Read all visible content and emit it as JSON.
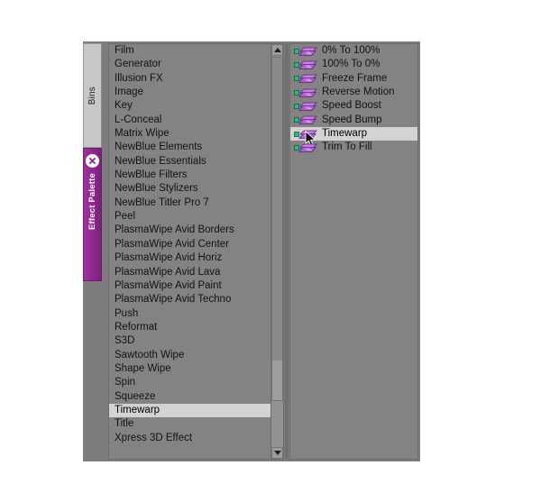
{
  "window": {
    "title": "Effect Palette",
    "background_color": "#7d7d7d"
  },
  "tabs": [
    {
      "id": "bins",
      "label": "Bins",
      "active": false,
      "color": "#c8c8c8"
    },
    {
      "id": "effect-palette",
      "label": "Effect Palette",
      "active": true,
      "color": "#8e2a8e"
    }
  ],
  "close_button": {
    "icon": "close-x-icon",
    "tooltip": "Close"
  },
  "categories": {
    "selected": "Timewarp",
    "items": [
      "Film",
      "Generator",
      "Illusion FX",
      "Image",
      "Key",
      "L-Conceal",
      "Matrix Wipe",
      "NewBlue Elements",
      "NewBlue Essentials",
      "NewBlue Filters",
      "NewBlue Stylizers",
      "NewBlue Titler Pro 7",
      "Peel",
      "PlasmaWipe Avid Borders",
      "PlasmaWipe Avid Center",
      "PlasmaWipe Avid Horiz",
      "PlasmaWipe Avid Lava",
      "PlasmaWipe Avid Paint",
      "PlasmaWipe Avid Techno",
      "Push",
      "Reformat",
      "S3D",
      "Sawtooth Wipe",
      "Shape Wipe",
      "Spin",
      "Squeeze",
      "Timewarp",
      "Title",
      "Xpress 3D Effect"
    ]
  },
  "scrollbar": {
    "up_arrow": "scroll-up-arrow-icon",
    "down_arrow": "scroll-down-arrow-icon"
  },
  "effects": {
    "selected": "Timewarp",
    "items": [
      {
        "label": "0% To 100%",
        "icon": "effect-icon"
      },
      {
        "label": "100% To 0%",
        "icon": "effect-icon"
      },
      {
        "label": "Freeze Frame",
        "icon": "effect-icon"
      },
      {
        "label": "Reverse Motion",
        "icon": "effect-icon"
      },
      {
        "label": "Speed Boost",
        "icon": "effect-icon"
      },
      {
        "label": "Speed Bump",
        "icon": "effect-icon"
      },
      {
        "label": "Timewarp",
        "icon": "effect-icon"
      },
      {
        "label": "Trim To Fill",
        "icon": "effect-icon"
      }
    ]
  },
  "cursor": {
    "icon": "mouse-pointer-icon",
    "over": "Timewarp"
  },
  "colors": {
    "accent_purple": "#8e2a8e",
    "selection_gray": "#d3d3d3",
    "panel_gray": "#838383",
    "window_gray": "#7d7d7d",
    "icon_purple": "#b060d8",
    "icon_green": "#22c07a"
  }
}
